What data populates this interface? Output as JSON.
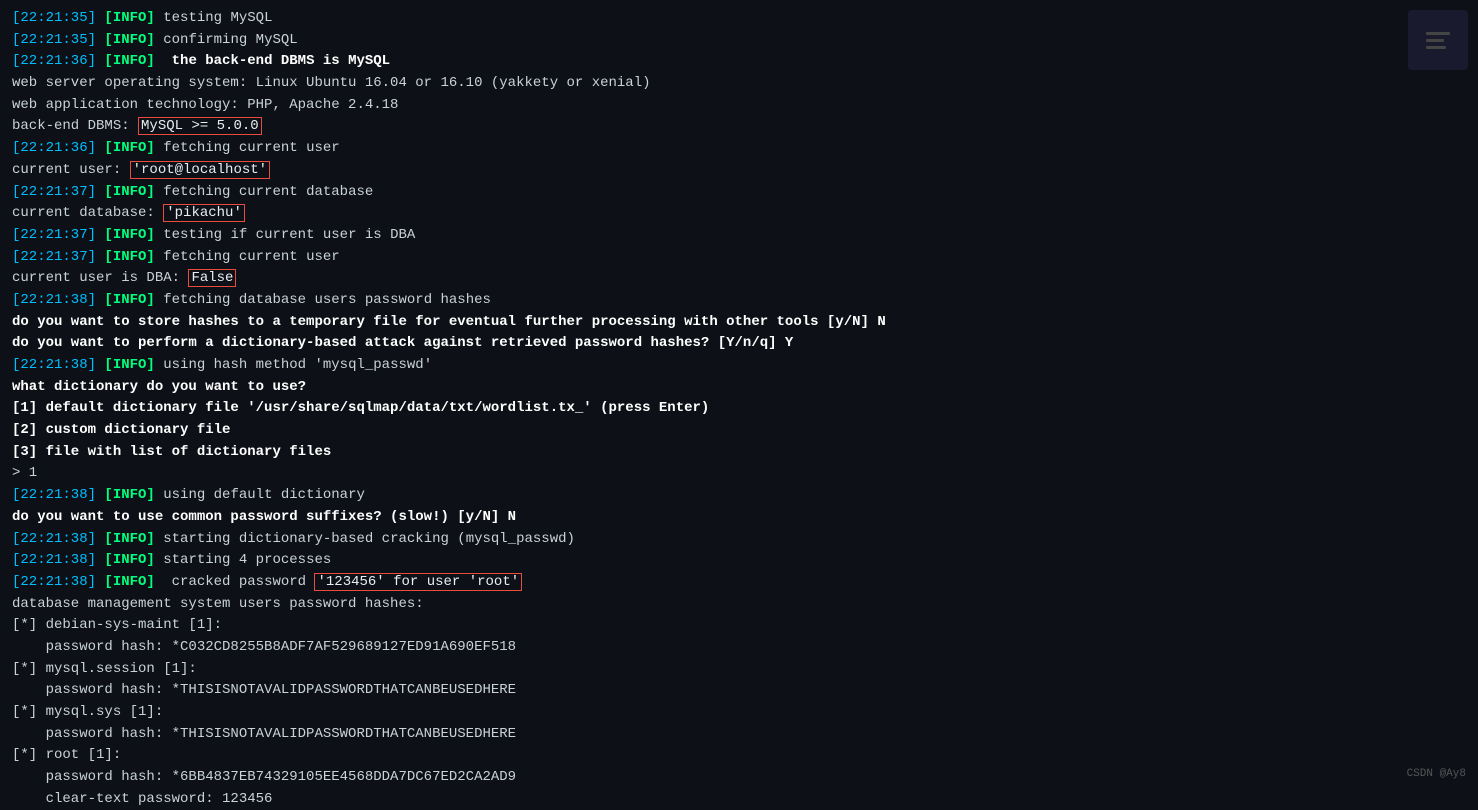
{
  "terminal": {
    "lines": [
      {
        "id": "l1",
        "type": "info",
        "content": "[22:21:35] [INFO] testing MySQL"
      },
      {
        "id": "l2",
        "type": "info",
        "content": "[22:21:35] [INFO] confirming MySQL"
      },
      {
        "id": "l3",
        "type": "info_bold",
        "content": "[22:21:36] [INFO] the back-end DBMS is MySQL"
      },
      {
        "id": "l4",
        "type": "normal",
        "content": "web server operating system: Linux Ubuntu 16.04 or 16.10 (yakkety or xenial)"
      },
      {
        "id": "l5",
        "type": "normal",
        "content": "web application technology: PHP, Apache 2.4.18"
      },
      {
        "id": "l6",
        "type": "normal_box",
        "prefix": "back-end DBMS: ",
        "boxed": "MySQL >= 5.0.0"
      },
      {
        "id": "l7",
        "type": "info",
        "content": "[22:21:36] [INFO] fetching current user"
      },
      {
        "id": "l8",
        "type": "normal_box",
        "prefix": "current user: ",
        "boxed": "'root@localhost'"
      },
      {
        "id": "l9",
        "type": "info",
        "content": "[22:21:37] [INFO] fetching current database"
      },
      {
        "id": "l10",
        "type": "normal_box",
        "prefix": "current database: ",
        "boxed": "'pikachu'"
      },
      {
        "id": "l11",
        "type": "info",
        "content": "[22:21:37] [INFO] testing if current user is DBA"
      },
      {
        "id": "l12",
        "type": "info",
        "content": "[22:21:37] [INFO] fetching current user"
      },
      {
        "id": "l13",
        "type": "normal_box",
        "prefix": "current user is DBA: ",
        "boxed": "False"
      },
      {
        "id": "l14",
        "type": "info",
        "content": "[22:21:38] [INFO] fetching database users password hashes"
      },
      {
        "id": "l15",
        "type": "bold",
        "content": "do you want to store hashes to a temporary file for eventual further processing with other tools [y/N] N"
      },
      {
        "id": "l16",
        "type": "bold",
        "content": "do you want to perform a dictionary-based attack against retrieved password hashes? [Y/n/q] Y"
      },
      {
        "id": "l17",
        "type": "info",
        "content": "[22:21:38] [INFO] using hash method 'mysql_passwd'"
      },
      {
        "id": "l18",
        "type": "bold",
        "content": "what dictionary do you want to use?"
      },
      {
        "id": "l19",
        "type": "bold",
        "content": "[1] default dictionary file '/usr/share/sqlmap/data/txt/wordlist.tx_' (press Enter)"
      },
      {
        "id": "l20",
        "type": "bold",
        "content": "[2] custom dictionary file"
      },
      {
        "id": "l21",
        "type": "bold",
        "content": "[3] file with list of dictionary files"
      },
      {
        "id": "l22",
        "type": "normal",
        "content": "> 1"
      },
      {
        "id": "l23",
        "type": "info",
        "content": "[22:21:38] [INFO] using default dictionary"
      },
      {
        "id": "l24",
        "type": "bold",
        "content": "do you want to use common password suffixes? (slow!) [y/N] N"
      },
      {
        "id": "l25",
        "type": "info",
        "content": "[22:21:38] [INFO] starting dictionary-based cracking (mysql_passwd)"
      },
      {
        "id": "l26",
        "type": "info",
        "content": "[22:21:38] [INFO] starting 4 processes"
      },
      {
        "id": "l27",
        "type": "info_cracked",
        "prefix": "[22:21:38] [INFO] cracked password ",
        "boxed": "'123456' for user 'root'"
      },
      {
        "id": "l28",
        "type": "normal",
        "content": "database management system users password hashes:"
      },
      {
        "id": "l29",
        "type": "normal",
        "content": "[*] debian-sys-maint [1]:"
      },
      {
        "id": "l30",
        "type": "normal",
        "content": "    password hash: *C032CD8255B8ADF7AF529689127ED91A690EF518"
      },
      {
        "id": "l31",
        "type": "normal",
        "content": "[*] mysql.session [1]:"
      },
      {
        "id": "l32",
        "type": "normal",
        "content": "    password hash: *THISISNOTAVALIDPASSWORDTHATCANBEUSEDHERE"
      },
      {
        "id": "l33",
        "type": "normal",
        "content": "[*] mysql.sys [1]:"
      },
      {
        "id": "l34",
        "type": "normal",
        "content": "    password hash: *THISISNOTAVALIDPASSWORDTHATCANBEUSEDHERE"
      },
      {
        "id": "l35",
        "type": "normal",
        "content": "[*] root [1]:"
      },
      {
        "id": "l36",
        "type": "normal",
        "content": "    password hash: *6BB4837EB74329105EE4568DDA7DC67ED2CA2AD9"
      },
      {
        "id": "l37",
        "type": "normal",
        "content": "    clear-text password: 123456"
      }
    ],
    "watermark": "CSDN @Ay8"
  }
}
